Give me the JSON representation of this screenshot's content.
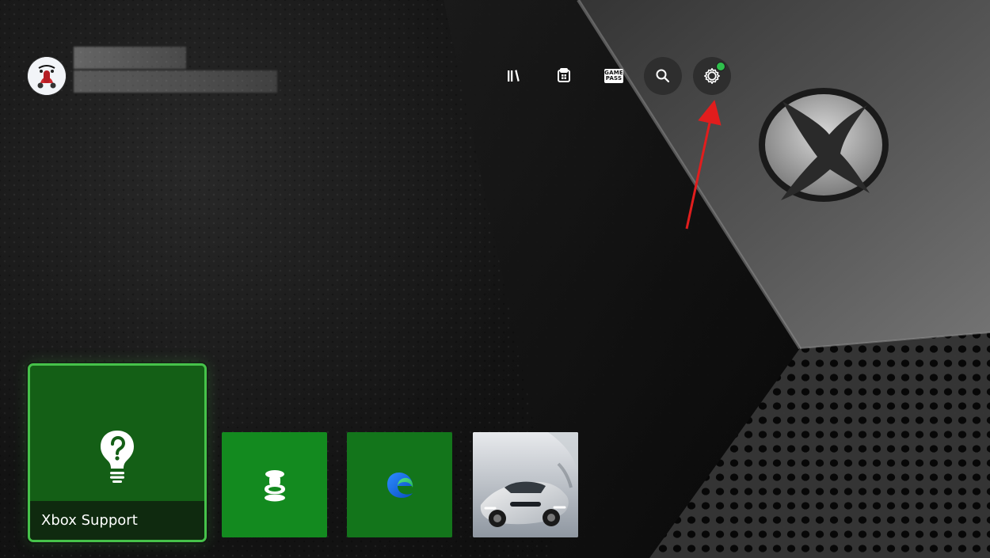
{
  "screen": {
    "name": "Xbox Home",
    "accent_green": "#46c34a",
    "tile_green": "#138a1f",
    "dot_green": "#2fbf4c",
    "arrow_red": "#e11d1d"
  },
  "profile": {
    "avatar_icon": "scooter-avatar"
  },
  "topnav": {
    "items": [
      {
        "icon": "library-icon"
      },
      {
        "icon": "store-icon"
      },
      {
        "icon": "gamepass-icon",
        "label": "GAME\nPASS"
      },
      {
        "icon": "search-icon"
      },
      {
        "icon": "gear-icon",
        "badge": "notification-dot"
      }
    ]
  },
  "tiles": {
    "featured": {
      "label": "Xbox Support",
      "icon": "support-bulb-icon"
    },
    "items": [
      {
        "icon": "controller-tile-icon"
      },
      {
        "icon": "edge-icon"
      },
      {
        "icon": "race-car-artwork"
      }
    ]
  }
}
